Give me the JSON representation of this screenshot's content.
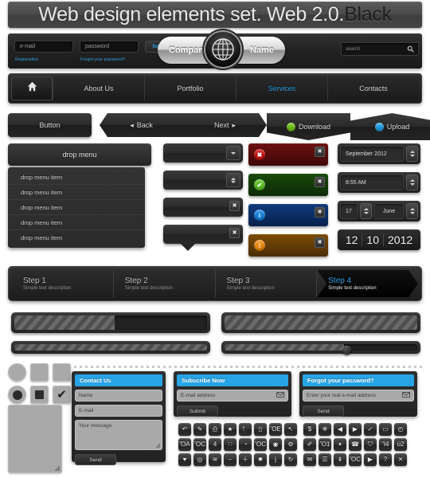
{
  "banner": {
    "title_light": "Web design elements set. Web 2.0.",
    "title_dark": "Black"
  },
  "topbar": {
    "email_placeholder": "e-mail",
    "password_placeholder": "password",
    "login_label": "login",
    "registration_link": "Registration",
    "forgot_link": "Forgot your password?",
    "logo_left": "Company",
    "logo_right": "Name",
    "search_placeholder": "search"
  },
  "nav": {
    "home_icon": "home-icon",
    "items": [
      {
        "label": "About Us",
        "active": false
      },
      {
        "label": "Portfolio",
        "active": false
      },
      {
        "label": "Services",
        "active": true
      },
      {
        "label": "Contacts",
        "active": false
      }
    ],
    "active_color": "#2f9fe0"
  },
  "buttons": [
    {
      "label": "Button",
      "name": "button-plain"
    },
    {
      "label": "Back",
      "name": "button-back",
      "arrow": "◂"
    },
    {
      "label": "Next",
      "name": "button-next",
      "arrow": "▸"
    },
    {
      "label": "Download",
      "name": "button-download",
      "dot_color": "#6fc214"
    },
    {
      "label": "Upload",
      "name": "button-upload",
      "dot_color": "#1e9ee0"
    }
  ],
  "dropmenu": {
    "header": "drop menu",
    "items": [
      "drop menu item",
      "drop menu item",
      "drop menu item",
      "drop menu item",
      "drop menu item"
    ]
  },
  "input_rows": [
    {
      "type": "select",
      "control": "chevron-down"
    },
    {
      "type": "spinner",
      "control": "up-down"
    },
    {
      "type": "closable",
      "control": "close"
    },
    {
      "type": "callout",
      "control": "close"
    }
  ],
  "alerts": [
    {
      "kind": "error",
      "bg": "#5c0d0d",
      "icon_color": "#cc1111",
      "glyph": "✖",
      "close": "✖"
    },
    {
      "kind": "success",
      "bg": "#133d09",
      "icon_color": "#5ec32a",
      "glyph": "✔",
      "close": "✖"
    },
    {
      "kind": "info",
      "bg": "#0d2d63",
      "icon_color": "#1785e0",
      "glyph": "i",
      "close": "✖"
    },
    {
      "kind": "warning",
      "bg": "#6b4206",
      "icon_color": "#ef8c12",
      "glyph": "!",
      "close": "✖"
    }
  ],
  "date_widgets": {
    "month_year": "September  2012",
    "time": "8:55 AM",
    "day": "17",
    "month": "June",
    "flip": [
      "12",
      "10",
      "2012"
    ]
  },
  "steps": [
    {
      "title": "Step 1",
      "desc": "Simple text description",
      "active": false
    },
    {
      "title": "Step 2",
      "desc": "Simple text description",
      "active": false
    },
    {
      "title": "Step 3",
      "desc": "Simple text description",
      "active": false
    },
    {
      "title": "Step 4",
      "desc": "Simple text description",
      "active": true
    }
  ],
  "progress": {
    "bar_left_fill_pct": 52,
    "bar_right_fill_pct": 100,
    "slider_left_fill_pct": 100,
    "slider_right_fill_pct": 62
  },
  "controls": {
    "radio_off": "radio-unchecked",
    "checkbox_off": "checkbox-unchecked",
    "radio_on": "radio-checked",
    "checkbox_on": "checkbox-checked",
    "check_mark": "✔"
  },
  "contact_form": {
    "title": "Contact Us",
    "name_placeholder": "Name",
    "email_placeholder": "E-mail",
    "message_placeholder": "Your message",
    "submit_label": "Send"
  },
  "subscribe_form": {
    "title": "Subscribe Now",
    "email_placeholder": "E-mail address",
    "submit_label": "Submit",
    "mail_icon": "envelope-icon"
  },
  "forgot_form": {
    "title": "Forgot your password?",
    "email_placeholder": "Enter your real e-mail address",
    "submit_label": "Send",
    "mail_icon": "envelope-icon"
  },
  "icon_grid": {
    "left": [
      "↶",
      "✎",
      "⎙",
      "★",
      "！",
      "▯",
      "ὋE",
      "↖",
      "ὌA",
      "ὋC",
      "὆4",
      "∷",
      "◔",
      "ὋC",
      "◉",
      "⚙",
      "♥",
      "◎",
      "≋",
      "−",
      "＋",
      "✹",
      "j",
      "↻"
    ],
    "right": [
      "$",
      "❄",
      "◀",
      "▶",
      "✓",
      "▭",
      "◴",
      "✐",
      "Ὂ1",
      "⏸",
      "☎",
      "⛉",
      "Ἲ4",
      "ὑ2",
      "✉",
      "☰",
      "⇟",
      "ὋC",
      "▶",
      "?",
      "✕"
    ]
  }
}
